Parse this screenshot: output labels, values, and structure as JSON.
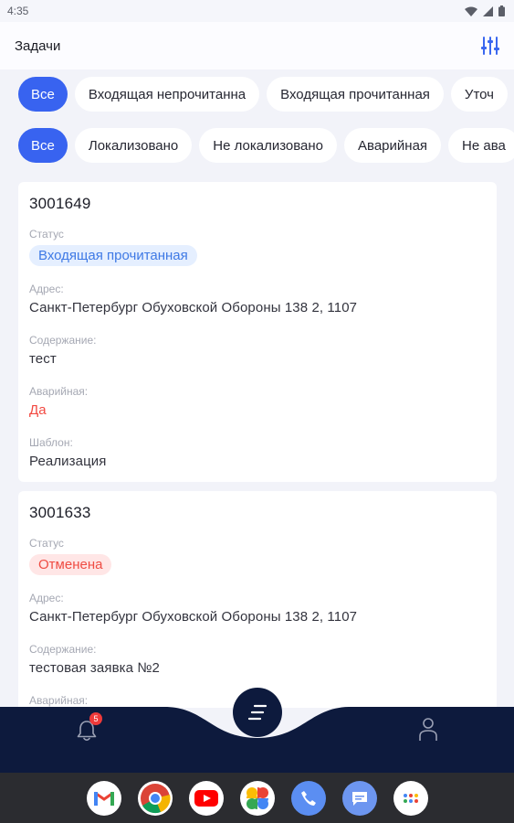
{
  "status_bar": {
    "time": "4:35"
  },
  "header": {
    "title": "Задачи"
  },
  "filters_row1": [
    "Все",
    "Входящая непрочитанна",
    "Входящая прочитанная",
    "Уточ"
  ],
  "filters_row2": [
    "Все",
    "Локализовано",
    "Не локализовано",
    "Аварийная",
    "Не ава"
  ],
  "labels": {
    "status": "Статус",
    "address": "Адрес:",
    "content": "Содержание:",
    "emergency": "Аварийная:",
    "template": "Шаблон:",
    "partial": "Аварийная:"
  },
  "cards": [
    {
      "id": "3001649",
      "status": "Входящая прочитанная",
      "address": "Санкт-Петербург Обуховской Обороны 138 2, 1107",
      "content": "тест",
      "emergency": "Да",
      "template": "Реализация"
    },
    {
      "id": "3001633",
      "status": "Отменена",
      "address": "Санкт-Петербург Обуховской Обороны 138 2, 1107",
      "content": "тестовая заявка №2"
    }
  ],
  "notifications": {
    "badge_count": "5"
  },
  "colors": {
    "accent": "#3863f0",
    "nav_bg": "#0d1a3d",
    "status_blue_bg": "#e5efff",
    "status_red_bg": "#ffe6e6",
    "danger": "#f24a42"
  },
  "dock_apps": [
    "gmail-icon",
    "chrome-icon",
    "youtube-icon",
    "photos-icon",
    "phone-icon",
    "messages-icon",
    "app-drawer-icon"
  ]
}
